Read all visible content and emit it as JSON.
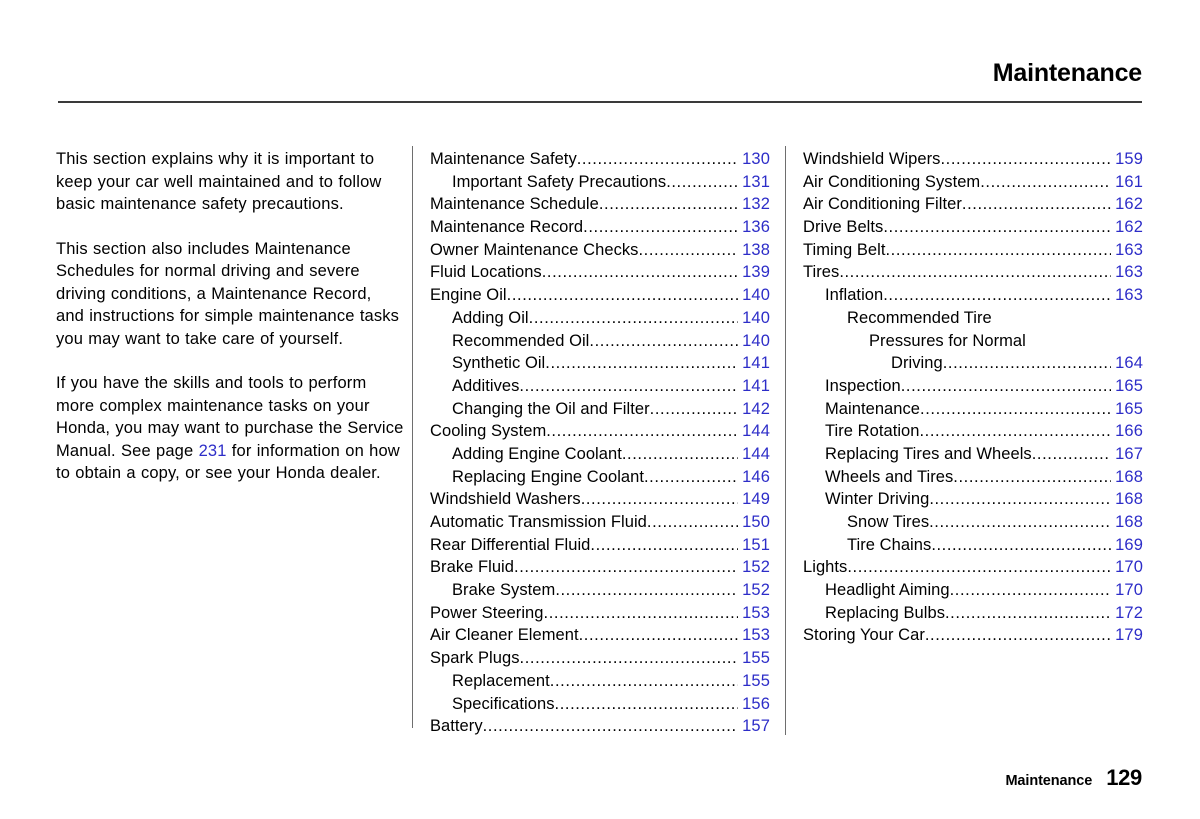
{
  "header": {
    "title": "Maintenance"
  },
  "intro": {
    "paragraphs": [
      "This section explains why it is important to keep your car well maintained and to follow basic maintenance safety precautions.",
      "This section also includes Maintenance Schedules for normal driving and severe driving conditions, a Maintenance Record, and instructions for simple maintenance tasks you may want to take care of yourself.",
      "If you have the skills and tools to perform more complex maintenance tasks on your Honda, you may want to purchase the Service Manual. See page |231| for information on how to obtain a copy, or see your Honda dealer."
    ],
    "page_reference": "231"
  },
  "toc_columns": [
    {
      "id": "toc-column-1",
      "entries": [
        {
          "label": "Maintenance Safety",
          "page": "130",
          "level": 0
        },
        {
          "label": "Important Safety Precautions",
          "page": "131",
          "level": 1
        },
        {
          "label": "Maintenance Schedule",
          "page": "132",
          "level": 0
        },
        {
          "label": "Maintenance Record",
          "page": "136",
          "level": 0
        },
        {
          "label": "Owner Maintenance Checks",
          "page": "138",
          "level": 0
        },
        {
          "label": "Fluid Locations",
          "page": "139",
          "level": 0
        },
        {
          "label": "Engine Oil",
          "page": "140",
          "level": 0
        },
        {
          "label": "Adding Oil",
          "page": "140",
          "level": 1
        },
        {
          "label": "Recommended Oil",
          "page": "140",
          "level": 1
        },
        {
          "label": "Synthetic Oil",
          "page": "141",
          "level": 1
        },
        {
          "label": "Additives",
          "page": "141",
          "level": 1
        },
        {
          "label": "Changing the Oil and Filter",
          "page": "142",
          "level": 1
        },
        {
          "label": "Cooling System",
          "page": "144",
          "level": 0
        },
        {
          "label": "Adding Engine Coolant",
          "page": "144",
          "level": 1
        },
        {
          "label": "Replacing Engine Coolant",
          "page": "146",
          "level": 1
        },
        {
          "label": "Windshield Washers",
          "page": "149",
          "level": 0
        },
        {
          "label": "Automatic Transmission Fluid",
          "page": "150",
          "level": 0
        },
        {
          "label": "Rear Differential Fluid",
          "page": "151",
          "level": 0
        },
        {
          "label": "Brake Fluid",
          "page": "152",
          "level": 0
        },
        {
          "label": "Brake System",
          "page": "152",
          "level": 1
        },
        {
          "label": "Power Steering",
          "page": "153",
          "level": 0
        },
        {
          "label": "Air Cleaner Element",
          "page": "153",
          "level": 0
        },
        {
          "label": "Spark Plugs",
          "page": "155",
          "level": 0
        },
        {
          "label": "Replacement",
          "page": "155",
          "level": 1
        },
        {
          "label": "Specifications",
          "page": "156",
          "level": 1
        },
        {
          "label": "Battery",
          "page": "157",
          "level": 0
        }
      ]
    },
    {
      "id": "toc-column-2",
      "entries": [
        {
          "label": "Windshield Wipers",
          "page": "159",
          "level": 0
        },
        {
          "label": "Air Conditioning System",
          "page": "161",
          "level": 0
        },
        {
          "label": "Air Conditioning Filter",
          "page": "162",
          "level": 0
        },
        {
          "label": "Drive Belts",
          "page": "162",
          "level": 0
        },
        {
          "label": "Timing Belt",
          "page": "163",
          "level": 0
        },
        {
          "label": "Tires",
          "page": "163",
          "level": 0
        },
        {
          "label": "Inflation",
          "page": "163",
          "level": 1
        },
        {
          "label": "Recommended Tire",
          "page": "",
          "level": 2,
          "leader": false
        },
        {
          "label": "Pressures for Normal",
          "page": "",
          "level": 3,
          "leader": false
        },
        {
          "label": "Driving",
          "page": "164",
          "level": 4
        },
        {
          "label": "Inspection",
          "page": "165",
          "level": 1
        },
        {
          "label": "Maintenance",
          "page": "165",
          "level": 1
        },
        {
          "label": "Tire Rotation",
          "page": "166",
          "level": 1
        },
        {
          "label": "Replacing Tires and Wheels",
          "page": "167",
          "level": 1
        },
        {
          "label": "Wheels and Tires",
          "page": "168",
          "level": 1
        },
        {
          "label": "Winter Driving",
          "page": "168",
          "level": 1
        },
        {
          "label": "Snow Tires",
          "page": "168",
          "level": 2
        },
        {
          "label": "Tire Chains",
          "page": "169",
          "level": 2
        },
        {
          "label": "Lights",
          "page": "170",
          "level": 0
        },
        {
          "label": "Headlight Aiming",
          "page": "170",
          "level": 1
        },
        {
          "label": "Replacing Bulbs",
          "page": "172",
          "level": 1
        },
        {
          "label": "Storing Your Car",
          "page": "179",
          "level": 0
        }
      ]
    }
  ],
  "footer": {
    "section": "Maintenance",
    "page_number": "129"
  },
  "colors": {
    "page_number_blue": "#2d2dc8",
    "text_black": "#000000",
    "rule_gray": "#3a3a3a",
    "divider_gray": "#6e6e6e",
    "background": "#ffffff"
  }
}
